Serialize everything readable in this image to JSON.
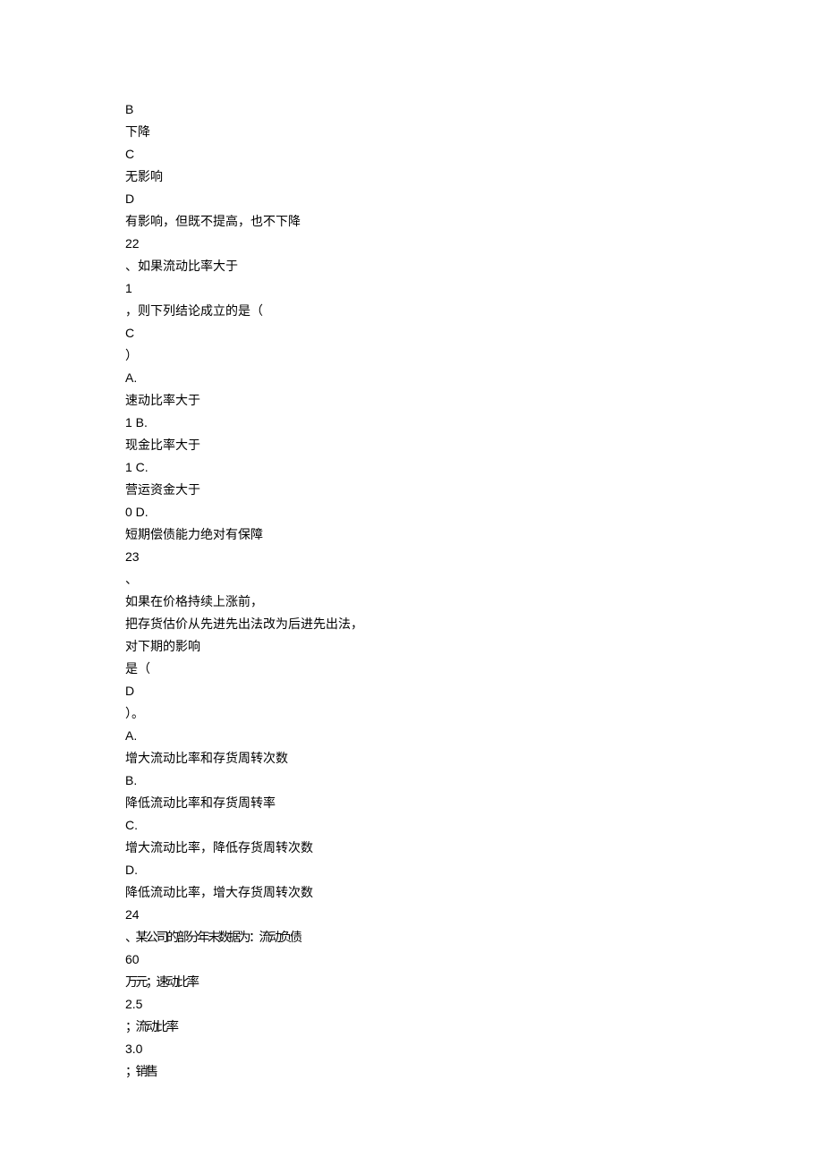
{
  "lines": [
    {
      "text": "B",
      "narrow": false
    },
    {
      "text": "下降",
      "narrow": false
    },
    {
      "text": "C",
      "narrow": false
    },
    {
      "text": "无影响",
      "narrow": false
    },
    {
      "text": "D",
      "narrow": false
    },
    {
      "text": "有影响，但既不提高，也不下降",
      "narrow": false
    },
    {
      "text": "22",
      "narrow": false
    },
    {
      "text": "、如果流动比率大于",
      "narrow": false
    },
    {
      "text": "1",
      "narrow": false
    },
    {
      "text": "，则下列结论成立的是（",
      "narrow": false
    },
    {
      "text": "C",
      "narrow": false
    },
    {
      "text": "）",
      "narrow": false
    },
    {
      "text": "A.",
      "narrow": false
    },
    {
      "text": "速动比率大于",
      "narrow": false
    },
    {
      "text": "1 B.",
      "narrow": false
    },
    {
      "text": "现金比率大于",
      "narrow": false
    },
    {
      "text": "1 C.",
      "narrow": false
    },
    {
      "text": "营运资金大于",
      "narrow": false
    },
    {
      "text": "0 D.",
      "narrow": false
    },
    {
      "text": "短期偿债能力绝对有保障",
      "narrow": false
    },
    {
      "text": "23",
      "narrow": false
    },
    {
      "text": "、",
      "narrow": false
    },
    {
      "text": "如果在价格持续上涨前，",
      "narrow": false
    },
    {
      "text": "把存货估价从先进先出法改为后进先出法，",
      "narrow": false
    },
    {
      "text": "对下期的影响",
      "narrow": false
    },
    {
      "text": "是（",
      "narrow": false
    },
    {
      "text": "D",
      "narrow": false
    },
    {
      "text": "）。",
      "narrow": false
    },
    {
      "text": "A.",
      "narrow": false
    },
    {
      "text": "增大流动比率和存货周转次数",
      "narrow": false
    },
    {
      "text": "B.",
      "narrow": false
    },
    {
      "text": "降低流动比率和存货周转率",
      "narrow": false
    },
    {
      "text": "C.",
      "narrow": false
    },
    {
      "text": "增大流动比率，降低存货周转次数",
      "narrow": false
    },
    {
      "text": "D.",
      "narrow": false
    },
    {
      "text": "降低流动比率，增大存货周转次数",
      "narrow": false
    },
    {
      "text": "24",
      "narrow": false
    },
    {
      "text": "、某公司的部分年末数据为：流动负债",
      "narrow": true
    },
    {
      "text": "60",
      "narrow": false
    },
    {
      "text": "万元；速动比率",
      "narrow": true
    },
    {
      "text": "2.5",
      "narrow": false
    },
    {
      "text": "；流动比率",
      "narrow": true
    },
    {
      "text": "3.0",
      "narrow": false
    },
    {
      "text": "；销售",
      "narrow": true
    }
  ]
}
